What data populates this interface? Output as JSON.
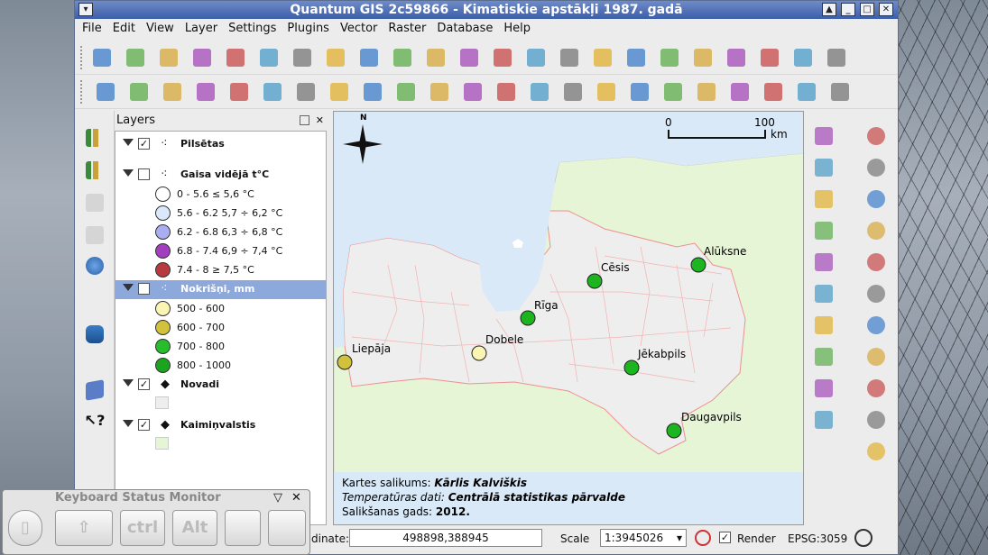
{
  "window": {
    "title": "Quantum GIS 2c59866 - Kimatiskie apstākļi 1987. gadā"
  },
  "menu": [
    "File",
    "Edit",
    "View",
    "Layer",
    "Settings",
    "Plugins",
    "Vector",
    "Raster",
    "Database",
    "Help"
  ],
  "toolbars": {
    "row1": [
      "new-project-icon",
      "open-project-icon",
      "save-project-icon",
      "save-as-icon",
      "print-preview-icon",
      "print-icon",
      "add-vector-icon",
      "add-raster-icon",
      "add-postgis-icon",
      "add-spatialite-icon",
      "add-mssql-icon",
      "add-wms-icon",
      "add-wcs-icon",
      "add-wfs-icon",
      "new-shapefile-icon",
      "remove-layer-icon",
      "add-delimited-text-icon",
      "spellcheck-icon",
      "plugin-icon-1",
      "plugin-icon-2",
      "plugin-icon-3",
      "plugin-icon-4",
      "plugin-icon-5"
    ],
    "row2": [
      "toggle-edit-icon",
      "pencil-icon",
      "save-edits-icon",
      "add-feature-icon",
      "move-feature-icon",
      "node-tool-icon",
      "delete-icon",
      "cut-icon",
      "copy-icon",
      "paste-icon",
      "undo-icon",
      "redo-icon",
      "simplify-icon",
      "add-ring-icon",
      "add-part-icon",
      "delete-ring-icon",
      "delete-part-icon",
      "reshape-icon",
      "offset-curve-icon",
      "split-icon",
      "merge-icon",
      "merge-attributes-icon",
      "rotate-icon"
    ]
  },
  "layers_panel": {
    "title": "Layers",
    "layers": [
      {
        "name": "Pilsētas",
        "checked": true,
        "icon": "point-layer-icon"
      },
      {
        "name": "Gaisa vidējā t°C",
        "checked": false,
        "icon": "point-layer-icon",
        "classes": [
          {
            "label": "0 - 5.6 ≤ 5,6 °C",
            "color": "#ffffff"
          },
          {
            "label": "5.6 - 6.2 5,7 ÷ 6,2 °C",
            "color": "#dbe8fb"
          },
          {
            "label": "6.2 - 6.8 6,3 ÷ 6,8 °C",
            "color": "#a9aef2"
          },
          {
            "label": "6.8 - 7.4 6,9 ÷ 7,4 °C",
            "color": "#a23fbf"
          },
          {
            "label": "7.4 - 8 ≥ 7,5 °C",
            "color": "#b93a3e"
          }
        ]
      },
      {
        "name": "Nokrišņi, mm",
        "checked": true,
        "icon": "point-layer-icon",
        "selected": true,
        "classes": [
          {
            "label": "500 - 600",
            "color": "#fbf5b4"
          },
          {
            "label": "600 - 700",
            "color": "#d2c13a"
          },
          {
            "label": "700 - 800",
            "color": "#27bd2c"
          },
          {
            "label": "800 - 1000",
            "color": "#1ba51f"
          }
        ]
      },
      {
        "name": "Novadi",
        "checked": true,
        "icon": "polygon-layer-icon",
        "swatch": "#eeeeee"
      },
      {
        "name": "Kaimiņvalstis",
        "checked": true,
        "icon": "polygon-layer-icon",
        "swatch": "#e6f5d6"
      }
    ]
  },
  "map": {
    "north": "N",
    "scalebar": {
      "start": "0",
      "end": "100",
      "unit": "km"
    },
    "cities": [
      {
        "name": "Alūksne",
        "color": "#1cb51f"
      },
      {
        "name": "Cēsis",
        "color": "#1cb51f"
      },
      {
        "name": "Rīga",
        "color": "#1cb51f"
      },
      {
        "name": "Liepāja",
        "color": "#d2c13a"
      },
      {
        "name": "Dobele",
        "color": "#fbf5b4"
      },
      {
        "name": "Jēkabpils",
        "color": "#1cb51f"
      },
      {
        "name": "Daugavpils",
        "color": "#1cb51f"
      }
    ],
    "credits": [
      {
        "label": "Kartes salikums: ",
        "value": "Kārlis Kalviškis",
        "italic": true
      },
      {
        "label": "Temperatūras dati: ",
        "value": "Centrālā statistikas pārvalde",
        "italic": true
      },
      {
        "label": "Salikšanas gads: ",
        "value": "2012.",
        "italic": false
      }
    ]
  },
  "statusbar": {
    "coord_label": "dinate:",
    "coordinate": "498898,388945",
    "scale_label": "Scale",
    "scale": "1:3945026",
    "render_label": "Render",
    "crs": "EPSG:3059"
  },
  "keyboard_monitor": {
    "title": "Keyboard Status Monitor",
    "keys": [
      "",
      "ctrl",
      "Alt",
      "",
      ""
    ]
  }
}
